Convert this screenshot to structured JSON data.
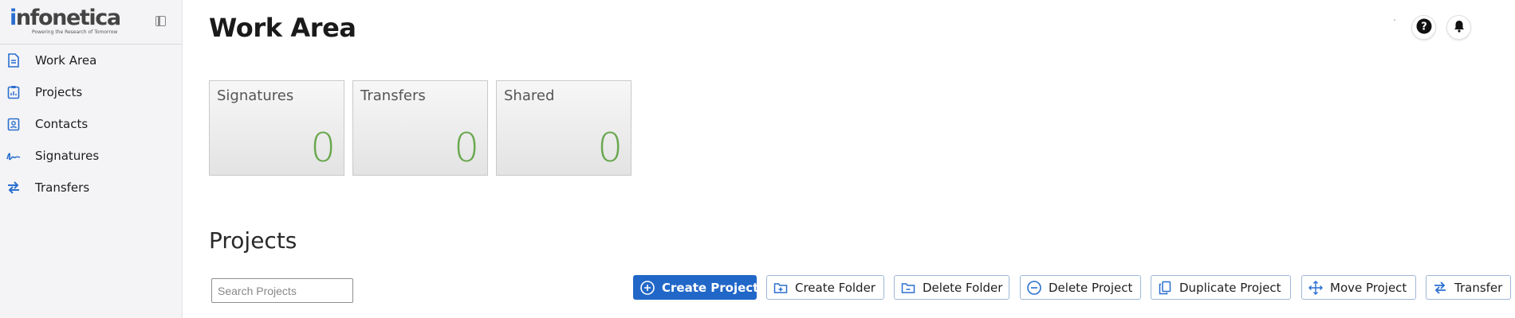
{
  "brand": {
    "name_first": "i",
    "name_rest": "nfonetica",
    "tagline": "Powering the Research of Tomorrow"
  },
  "sidebar": {
    "items": [
      {
        "label": "Work Area",
        "icon": "document-icon"
      },
      {
        "label": "Projects",
        "icon": "clipboard-chart-icon"
      },
      {
        "label": "Contacts",
        "icon": "contact-card-icon"
      },
      {
        "label": "Signatures",
        "icon": "signature-icon"
      },
      {
        "label": "Transfers",
        "icon": "transfer-arrows-icon"
      }
    ]
  },
  "header": {
    "title": "Work Area"
  },
  "summary_cards": [
    {
      "label": "Signatures",
      "count": "0"
    },
    {
      "label": "Transfers",
      "count": "0"
    },
    {
      "label": "Shared",
      "count": "0"
    }
  ],
  "projects": {
    "title": "Projects",
    "search_placeholder": "Search Projects",
    "actions": [
      {
        "label": "Create Project",
        "icon": "plus-circle-icon",
        "primary": true
      },
      {
        "label": "Create Folder",
        "icon": "folder-plus-icon"
      },
      {
        "label": "Delete Folder",
        "icon": "folder-minus-icon"
      },
      {
        "label": "Delete Project",
        "icon": "minus-circle-icon"
      },
      {
        "label": "Duplicate Project",
        "icon": "copy-icon"
      },
      {
        "label": "Move Project",
        "icon": "move-icon"
      },
      {
        "label": "Transfer",
        "icon": "transfer-arrows-icon"
      }
    ]
  },
  "colors": {
    "accent": "#2167c8",
    "count": "#6aa84f",
    "sidebar_bg": "#f4f4f6"
  }
}
